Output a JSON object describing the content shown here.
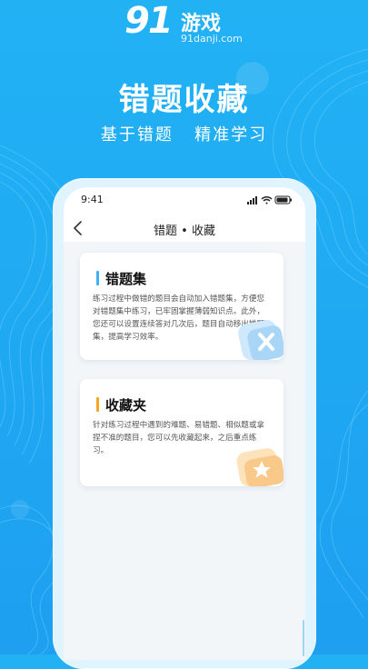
{
  "brand": {
    "number": "91",
    "name": "游戏",
    "domain": "91danji.com"
  },
  "promo": {
    "headline": "错题收藏",
    "subline": "基于错题   精准学习"
  },
  "device": {
    "time": "9:41",
    "status_icons": [
      "signal-icon",
      "wifi-icon",
      "battery-icon"
    ]
  },
  "navbar": {
    "title": "错题 • 收藏",
    "back_icon": "chevron-left-icon"
  },
  "cards": [
    {
      "title": "错题集",
      "accent": "#3fb0f5",
      "description": "练习过程中做错的题目会自动加入错题集，方便您对错题集中练习，已牢固掌握薄弱知识点。此外，您还可以设置连续答对几次后，题目自动移出错题集，提高学习效率。",
      "icon": "close-badge-icon"
    },
    {
      "title": "收藏夹",
      "accent": "#f5a623",
      "description": "针对练习过程中遇到的难题、易错题、相似题或拿捏不准的题目，您可以先收藏起来，之后重点练习。",
      "icon": "star-folder-icon"
    }
  ],
  "colors": {
    "background": "#22b2f4",
    "phone_frame": "#dff4ff",
    "card_bg": "#ffffff"
  }
}
